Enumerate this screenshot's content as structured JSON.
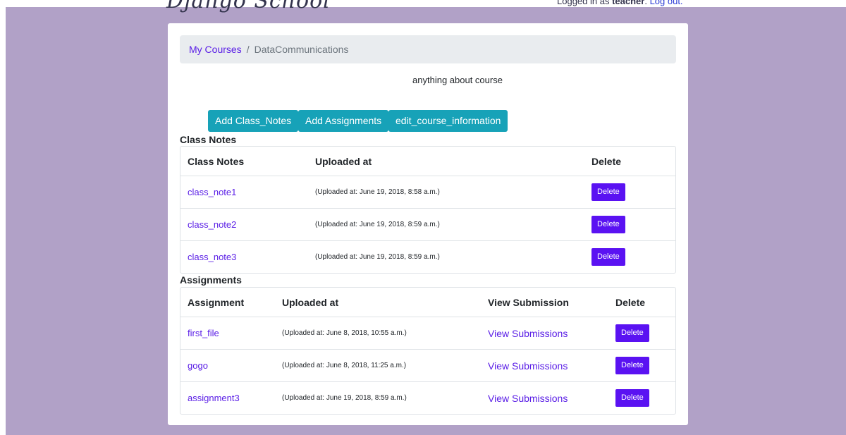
{
  "header": {
    "brand": "Django School",
    "login_prefix": "Logged in as ",
    "login_user": "teacher",
    "login_suffix": ". ",
    "logout_label": "Log out."
  },
  "breadcrumb": {
    "root": "My Courses",
    "separator": "/",
    "current": "DataCommunications"
  },
  "course": {
    "description": "anything about course"
  },
  "actions": {
    "add_notes": "Add Class_Notes",
    "add_assignments": "Add Assignments",
    "edit_course": "edit_course_information"
  },
  "class_notes": {
    "section_title": "Class Notes",
    "columns": [
      "Class Notes",
      "Uploaded at",
      "Delete"
    ],
    "rows": [
      {
        "name": "class_note1",
        "uploaded": "(Uploaded at: June 19, 2018, 8:58 a.m.)",
        "delete": "Delete"
      },
      {
        "name": "class_note2",
        "uploaded": "(Uploaded at: June 19, 2018, 8:59 a.m.)",
        "delete": "Delete"
      },
      {
        "name": "class_note3",
        "uploaded": "(Uploaded at: June 19, 2018, 8:59 a.m.)",
        "delete": "Delete"
      }
    ]
  },
  "assignments": {
    "section_title": "Assignments",
    "columns": [
      "Assignment",
      "Uploaded at",
      "View Submission",
      "Delete"
    ],
    "rows": [
      {
        "name": "first_file",
        "uploaded": "(Uploaded at: June 8, 2018, 10:55 a.m.)",
        "view": "View Submissions",
        "delete": "Delete"
      },
      {
        "name": "gogo",
        "uploaded": "(Uploaded at: June 8, 2018, 11:25 a.m.)",
        "view": "View Submissions",
        "delete": "Delete"
      },
      {
        "name": "assignment3",
        "uploaded": "(Uploaded at: June 19, 2018, 8:59 a.m.)",
        "view": "View Submissions",
        "delete": "Delete"
      }
    ]
  },
  "colors": {
    "page_background": "#b1a1c7",
    "primary_button": "#17a2b8",
    "delete_button": "#5a12f2",
    "link": "#5a1ee6"
  }
}
